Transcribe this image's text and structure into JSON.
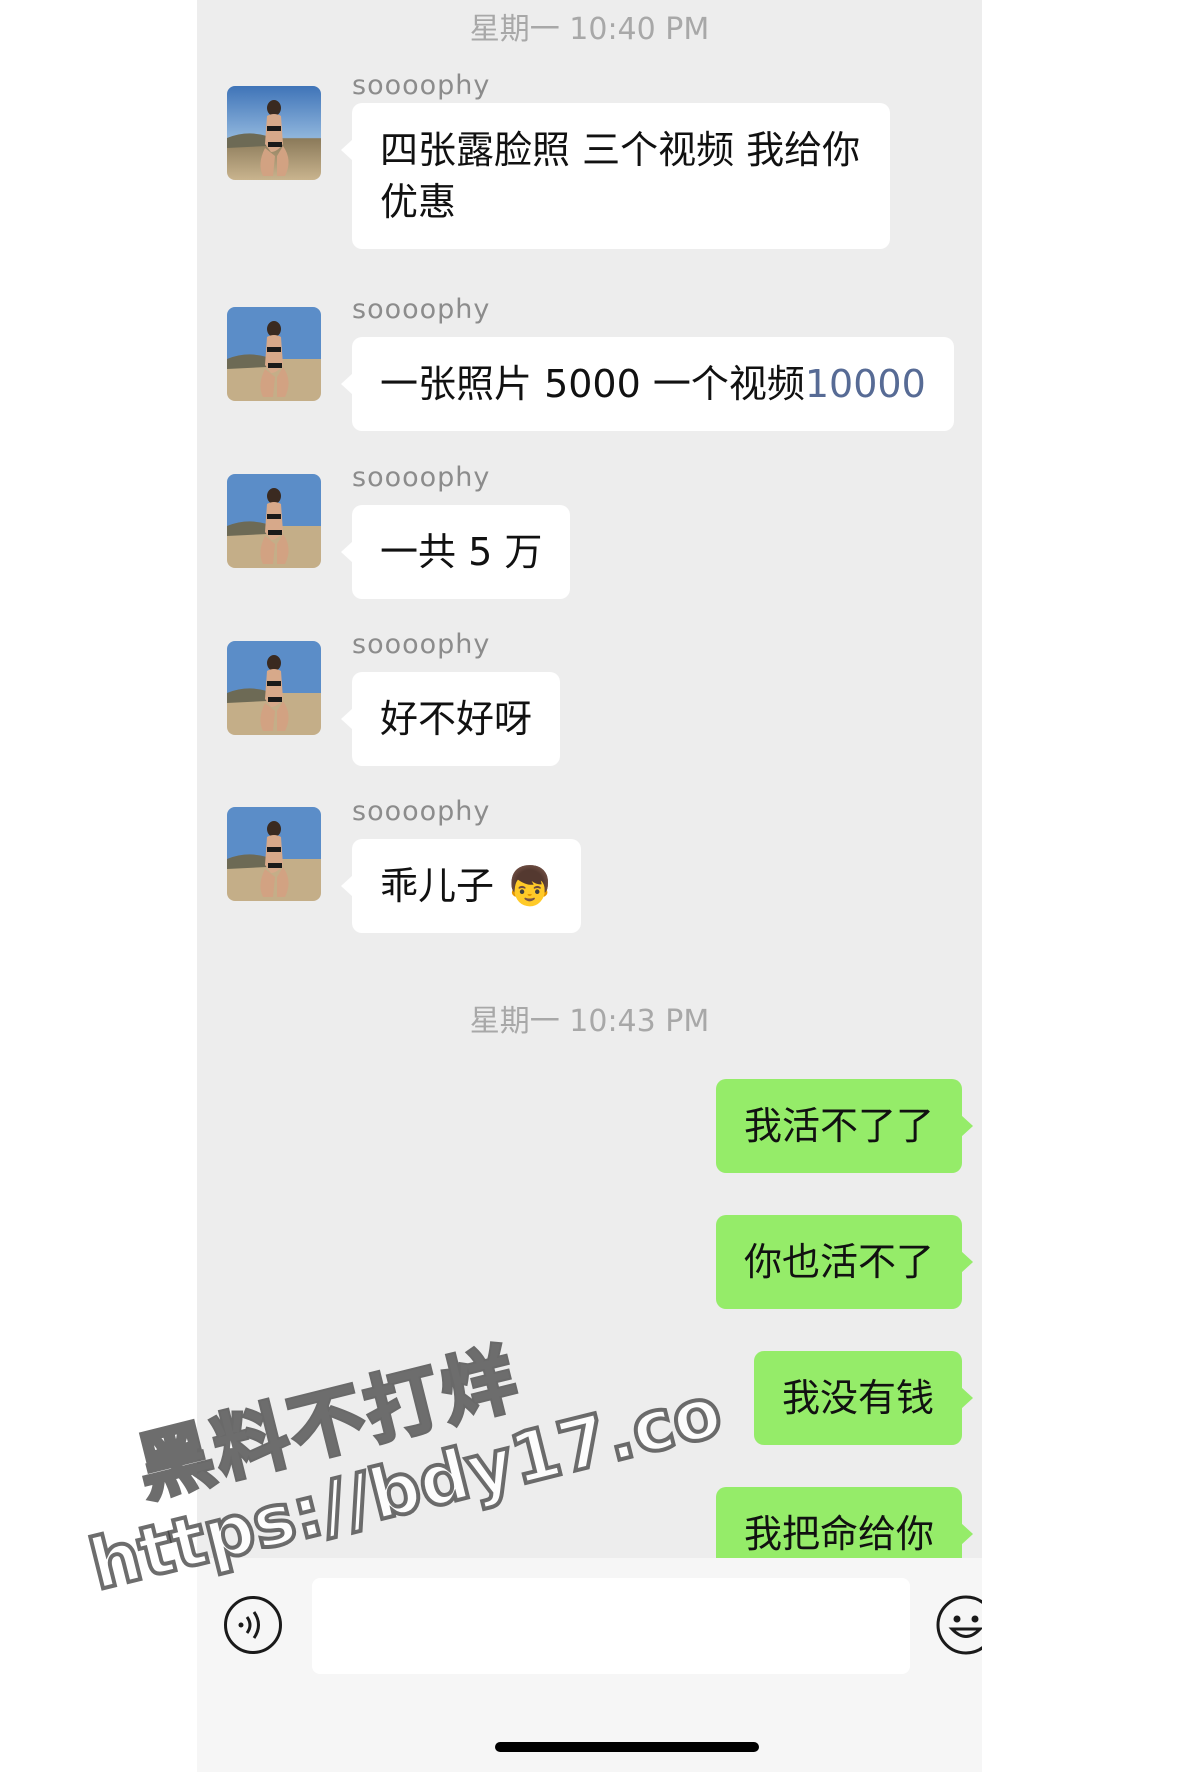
{
  "timestamps": [
    "星期一 10:40 PM",
    "星期一 10:43 PM"
  ],
  "incoming": [
    {
      "sender": "soooophy",
      "text": "四张露脸照 三个视频 我给你优惠"
    },
    {
      "sender": "soooophy",
      "text_plain": "一张照片 5000 一个视频",
      "text_link": "10000"
    },
    {
      "sender": "soooophy",
      "text": "一共 5 万"
    },
    {
      "sender": "soooophy",
      "text": "好不好呀"
    },
    {
      "sender": "soooophy",
      "text": "乖儿子 👦"
    }
  ],
  "outgoing": [
    {
      "text": "我活不了了"
    },
    {
      "text": "你也活不了"
    },
    {
      "text": "我没有钱"
    },
    {
      "text": "我把命给你"
    }
  ],
  "input_bar": {
    "voice_icon": "voice-icon",
    "emoji_icon": "smiley-face-icon",
    "input_value": ""
  },
  "watermark": {
    "line1": "黑料不打烊",
    "line2": "https://bdy17.co"
  },
  "colors": {
    "chat_background": "#ededed",
    "incoming_bubble": "#ffffff",
    "outgoing_bubble": "#95ec69",
    "link_text": "#576b95",
    "timestamp": "#a8a8a8"
  }
}
